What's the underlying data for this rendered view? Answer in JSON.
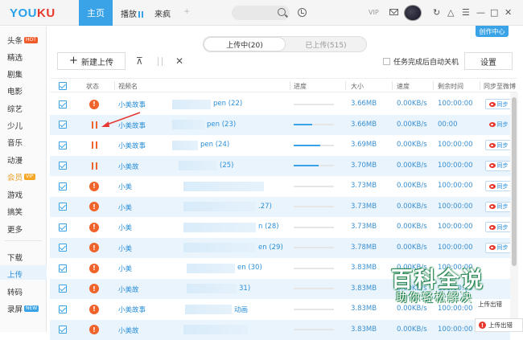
{
  "topbar": {
    "logo_you": "YOU",
    "logo_ku": "KU",
    "home": "主页",
    "tab_play": "播放",
    "tab_crazy": "来疯",
    "tab_add": "+",
    "vip": "VIP",
    "create_center": "创作中心"
  },
  "sidebar": {
    "items": [
      {
        "label": "头条",
        "badge": "HOT"
      },
      {
        "label": "精选"
      },
      {
        "label": "剧集"
      },
      {
        "label": "电影"
      },
      {
        "label": "综艺"
      },
      {
        "label": "少儿"
      },
      {
        "label": "音乐"
      },
      {
        "label": "动漫"
      },
      {
        "label": "会员",
        "badge": "VIP"
      },
      {
        "label": "游戏"
      },
      {
        "label": "搞笑"
      },
      {
        "label": "更多"
      },
      {
        "label": "下载"
      },
      {
        "label": "上传"
      },
      {
        "label": "转码"
      },
      {
        "label": "录屏",
        "badge": "NEW"
      }
    ]
  },
  "upload_tabs": {
    "uploading": "上传中(20)",
    "uploaded": "已上传(515)"
  },
  "toolbar": {
    "new_upload": "新建上传",
    "auto_shutdown": "任务完成后自动关机",
    "settings": "设置"
  },
  "table": {
    "headers": [
      "状态",
      "视频名",
      "进度",
      "大小",
      "速度",
      "剩余时间",
      "同步至微博"
    ],
    "rows": [
      {
        "status": "warn",
        "name": "小美故事",
        "suffix": "pen (22)",
        "progress": 0,
        "size": "3.66MB",
        "speed": "0.00KB/s",
        "remaining": "100:00:00",
        "sync": "同步",
        "sync_boxed": true
      },
      {
        "status": "pause",
        "name": "小美故事",
        "suffix": "pen (23)",
        "progress": 0.45,
        "size": "3.66MB",
        "speed": "0.00KB/s",
        "remaining": "00:00",
        "sync": "同步",
        "sync_boxed": false
      },
      {
        "status": "pause",
        "name": "小美故事",
        "suffix": "pen (24)",
        "progress": 0.65,
        "size": "3.69MB",
        "speed": "0.00KB/s",
        "remaining": "100:00:00",
        "sync": "同步",
        "sync_boxed": true
      },
      {
        "status": "pause",
        "name": "小美故",
        "suffix": "(25)",
        "progress": 0.62,
        "size": "3.70MB",
        "speed": "0.00KB/s",
        "remaining": "100:00:00",
        "sync": "同步",
        "sync_boxed": true
      },
      {
        "status": "warn",
        "name": "小美",
        "suffix": "",
        "progress": 0,
        "size": "3.73MB",
        "speed": "0.00KB/s",
        "remaining": "100:00:00",
        "sync": "同步",
        "sync_boxed": true
      },
      {
        "status": "warn",
        "name": "小美",
        "suffix": ".27)",
        "progress": 0,
        "size": "3.73MB",
        "speed": "0.00KB/s",
        "remaining": "100:00:00",
        "sync": "同步",
        "sync_boxed": true
      },
      {
        "status": "warn",
        "name": "小美",
        "suffix": "n (28)",
        "progress": 0,
        "size": "3.73MB",
        "speed": "0.00KB/s",
        "remaining": "100:00:00",
        "sync": "同步",
        "sync_boxed": true
      },
      {
        "status": "warn",
        "name": "小美",
        "suffix": "en (29)",
        "progress": 0,
        "size": "3.78MB",
        "speed": "0.00KB/s",
        "remaining": "100:00:00",
        "sync": "同步",
        "sync_boxed": true
      },
      {
        "status": "warn",
        "name": "小美",
        "suffix": "en (30)",
        "progress": 0,
        "size": "3.83MB",
        "speed": "0.00KB/s",
        "remaining": "100:00:00",
        "sync": "",
        "sync_boxed": false
      },
      {
        "status": "warn",
        "name": "小美故",
        "suffix": "31)",
        "progress": 0,
        "size": "3.83MB",
        "speed": "0.00KB/s",
        "remaining": "100:00:00",
        "sync": "",
        "sync_boxed": false
      },
      {
        "status": "warn",
        "name": "小美故事",
        "suffix": "动画",
        "progress": 0,
        "size": "3.83MB",
        "speed": "0.00KB/s",
        "remaining": "100:00:00",
        "sync": "",
        "sync_boxed": false
      },
      {
        "status": "warn",
        "name": "小美故",
        "suffix": "",
        "progress": 0,
        "size": "3.83MB",
        "speed": "0.00KB/s",
        "remaining": "100:00:00",
        "sync": "",
        "sync_boxed": false
      }
    ]
  },
  "watermark": {
    "title": "百科全说",
    "subtitle": "助你轻松解决"
  },
  "upload_error": "上传出错",
  "upload_error_partial": "上传出错"
}
